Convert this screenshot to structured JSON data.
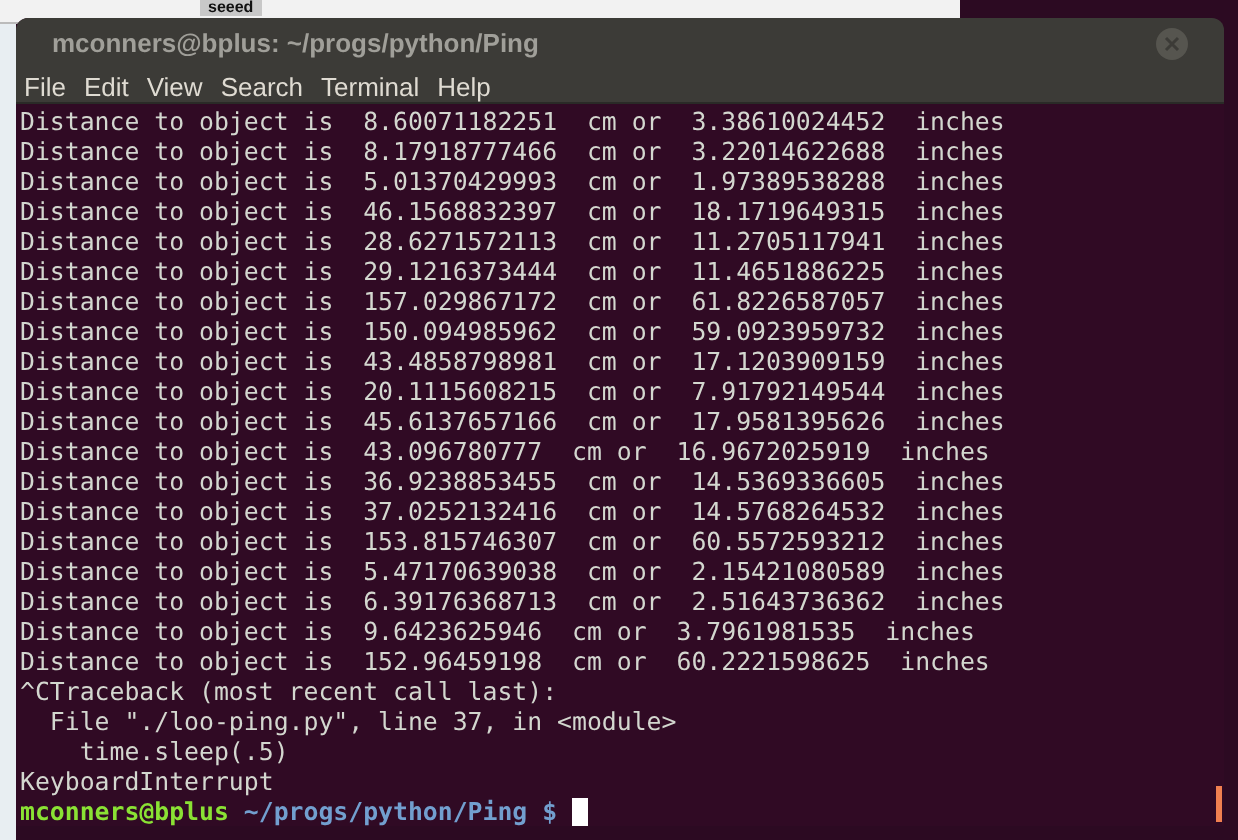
{
  "background_window": {
    "label": "seeed"
  },
  "window": {
    "title": "mconners@bplus: ~/progs/python/Ping"
  },
  "menu": [
    "File",
    "Edit",
    "View",
    "Search",
    "Terminal",
    "Help"
  ],
  "lines": [
    "Distance to object is  8.60071182251  cm or  3.38610024452  inches",
    "Distance to object is  8.17918777466  cm or  3.22014622688  inches",
    "Distance to object is  5.01370429993  cm or  1.97389538288  inches",
    "Distance to object is  46.1568832397  cm or  18.1719649315  inches",
    "Distance to object is  28.6271572113  cm or  11.2705117941  inches",
    "Distance to object is  29.1216373444  cm or  11.4651886225  inches",
    "Distance to object is  157.029867172  cm or  61.8226587057  inches",
    "Distance to object is  150.094985962  cm or  59.0923959732  inches",
    "Distance to object is  43.4858798981  cm or  17.1203909159  inches",
    "Distance to object is  20.1115608215  cm or  7.91792149544  inches",
    "Distance to object is  45.6137657166  cm or  17.9581395626  inches",
    "Distance to object is  43.096780777  cm or  16.9672025919  inches",
    "Distance to object is  36.9238853455  cm or  14.5369336605  inches",
    "Distance to object is  37.0252132416  cm or  14.5768264532  inches",
    "Distance to object is  153.815746307  cm or  60.5572593212  inches",
    "Distance to object is  5.47170639038  cm or  2.15421080589  inches",
    "Distance to object is  6.39176368713  cm or  2.51643736362  inches",
    "Distance to object is  9.6423625946  cm or  3.7961981535  inches",
    "Distance to object is  152.96459198  cm or  60.2221598625  inches",
    "^CTraceback (most recent call last):",
    "  File \"./loo-ping.py\", line 37, in <module>",
    "    time.sleep(.5)",
    "KeyboardInterrupt"
  ],
  "prompt": {
    "user_host": "mconners@bplus",
    "path": "~/progs/python/Ping $"
  }
}
